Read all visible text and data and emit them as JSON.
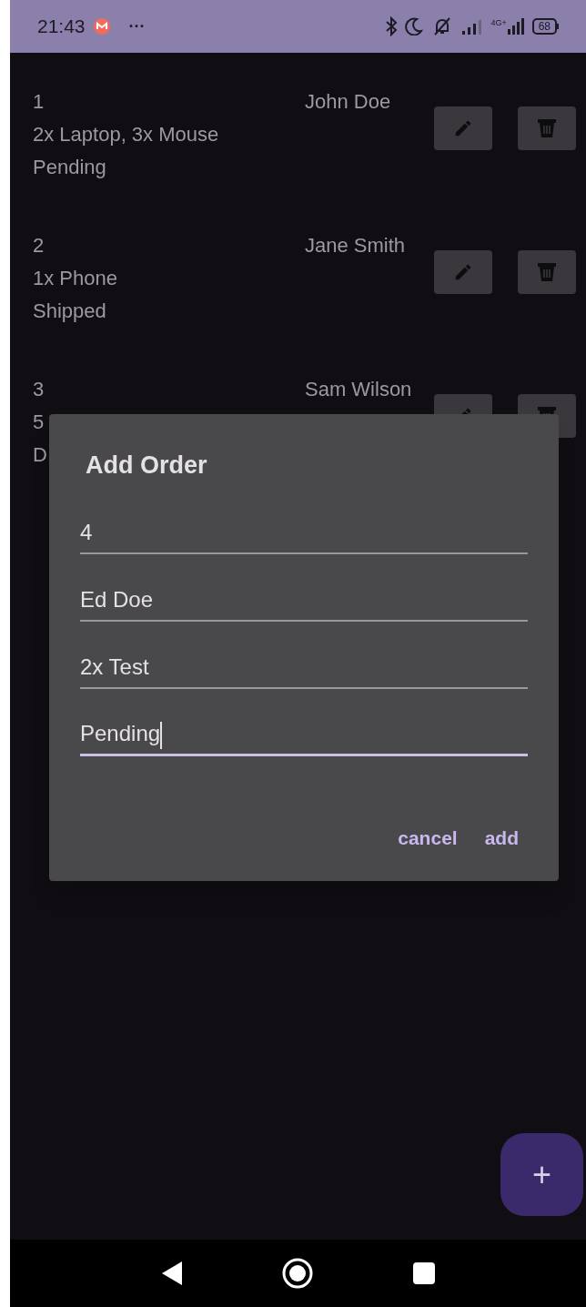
{
  "status_bar": {
    "time": "21:43",
    "more": "···",
    "network": "4G+",
    "battery": "68"
  },
  "orders": [
    {
      "id": "1",
      "items": "2x Laptop, 3x Mouse",
      "status": "Pending",
      "customer": "John Doe"
    },
    {
      "id": "2",
      "items": "1x Phone",
      "status": "Shipped",
      "customer": "Jane Smith"
    },
    {
      "id": "3",
      "items": "5",
      "status": "D",
      "customer": "Sam Wilson"
    }
  ],
  "dialog": {
    "title": "Add Order",
    "fields": [
      {
        "value": "4",
        "focused": false
      },
      {
        "value": "Ed Doe",
        "focused": false
      },
      {
        "value": "2x Test",
        "focused": false
      },
      {
        "value": "Pending",
        "focused": true
      }
    ],
    "buttons": [
      "cancel",
      "add"
    ]
  },
  "fab": {
    "label": "+"
  }
}
